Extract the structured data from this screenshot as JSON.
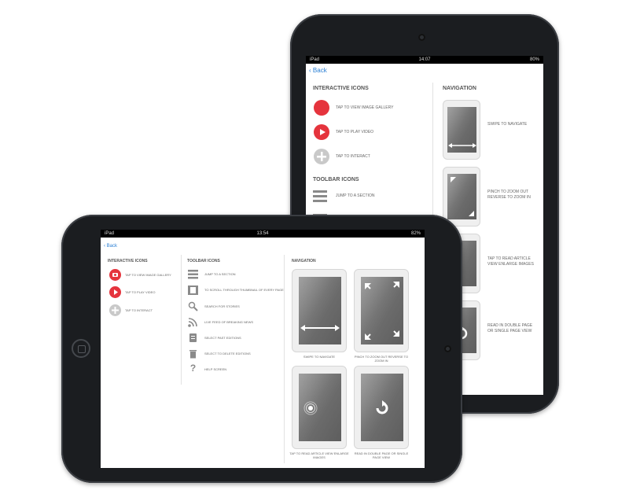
{
  "back_device": {
    "status": {
      "carrier": "iPad",
      "time": "14:07",
      "battery": "80%"
    },
    "back_label": "Back",
    "interactive": {
      "title": "INTERACTIVE ICONS",
      "items": [
        "TAP TO VIEW IMAGE GALLERY",
        "TAP TO PLAY VIDEO",
        "TAP TO INTERACT"
      ]
    },
    "toolbar": {
      "title": "TOOLBAR ICONS",
      "items": [
        "JUMP TO A SECTION"
      ]
    },
    "navigation": {
      "title": "NAVIGATION",
      "items": [
        "SWIPE TO NAVIGATE",
        "PINCH TO ZOOM OUT",
        "REVERSE TO ZOOM IN",
        "TAP TO READ ARTICLE",
        "VIEW ENLARGE IMAGES",
        "READ IN DOUBLE PAGE",
        "OR SINGLE PAGE VIEW"
      ]
    }
  },
  "front_device": {
    "status": {
      "carrier": "iPad",
      "time": "13:54",
      "battery": "82%"
    },
    "back_label": "Back",
    "interactive": {
      "title": "INTERACTIVE ICONS",
      "items": [
        "TAP TO VIEW IMAGE GALLERY",
        "TAP TO PLAY VIDEO",
        "TAP TO INTERACT"
      ]
    },
    "toolbar": {
      "title": "TOOLBAR ICONS",
      "items": [
        "JUMP TO A SECTION",
        "TO SCROLL THROUGH THUMBNAIL OF EVERY PAGE",
        "SEARCH FOR STORIES",
        "LIVE FEED OF BREAKING NEWS",
        "SELECT PAST EDITIONS",
        "SELECT TO DELETE EDITIONS",
        "HELP SCREEN"
      ],
      "help_glyph": "?"
    },
    "navigation": {
      "title": "NAVIGATION",
      "items": [
        "SWIPE TO NAVIGATE",
        "PINCH TO ZOOM OUT REVERSE TO ZOOM IN",
        "TAP TO READ ARTICLE VIEW ENLARGE IMAGES",
        "READ IN DOUBLE PAGE OR SINGLE PAGE VIEW"
      ]
    }
  },
  "colors": {
    "accent_red": "#e5343d",
    "link_blue": "#2a7fd4",
    "device_body": "#1b1d20"
  }
}
